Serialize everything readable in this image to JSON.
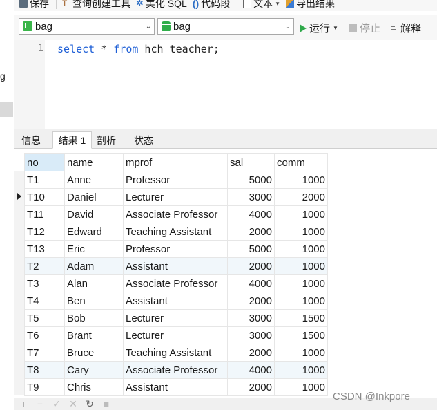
{
  "left_fragment": "g",
  "toolbar": {
    "save": "保存",
    "query_builder": "查询创建工具",
    "beautify": "美化 SQL",
    "snippet": "代码段",
    "text": "文本",
    "export": "导出结果"
  },
  "selectors": {
    "connection": "bag",
    "database": "bag"
  },
  "actions": {
    "run": "运行",
    "stop": "停止",
    "explain": "解释"
  },
  "editor": {
    "line": "1",
    "kw_select": "select",
    "star": " * ",
    "kw_from": "from",
    "table": " hch_teacher;"
  },
  "tabs": [
    "信息",
    "结果 1",
    "剖析",
    "状态"
  ],
  "grid": {
    "columns": [
      "no",
      "name",
      "mprof",
      "sal",
      "comm"
    ],
    "rows": [
      [
        "T1",
        "Anne",
        "Professor",
        "5000",
        "1000"
      ],
      [
        "T10",
        "Daniel",
        "Lecturer",
        "3000",
        "2000"
      ],
      [
        "T11",
        "David",
        "Associate Professor",
        "4000",
        "1000"
      ],
      [
        "T12",
        "Edward",
        "Teaching Assistant",
        "2000",
        "1000"
      ],
      [
        "T13",
        "Eric",
        "Professor",
        "5000",
        "1000"
      ],
      [
        "T2",
        "Adam",
        "Assistant",
        "2000",
        "1000"
      ],
      [
        "T3",
        "Alan",
        "Associate Professor",
        "4000",
        "1000"
      ],
      [
        "T4",
        "Ben",
        "Assistant",
        "2000",
        "1000"
      ],
      [
        "T5",
        "Bob",
        "Lecturer",
        "3000",
        "1500"
      ],
      [
        "T6",
        "Brant",
        "Lecturer",
        "3000",
        "1500"
      ],
      [
        "T7",
        "Bruce",
        "Teaching Assistant",
        "2000",
        "1000"
      ],
      [
        "T8",
        "Cary",
        "Associate Professor",
        "4000",
        "1000"
      ],
      [
        "T9",
        "Chris",
        "Assistant",
        "2000",
        "1000"
      ]
    ],
    "current_row": 1
  },
  "bottom_buttons": [
    "+",
    "−",
    "✓",
    "✕",
    "↻",
    "■"
  ],
  "watermark": "CSDN @Inkpore"
}
